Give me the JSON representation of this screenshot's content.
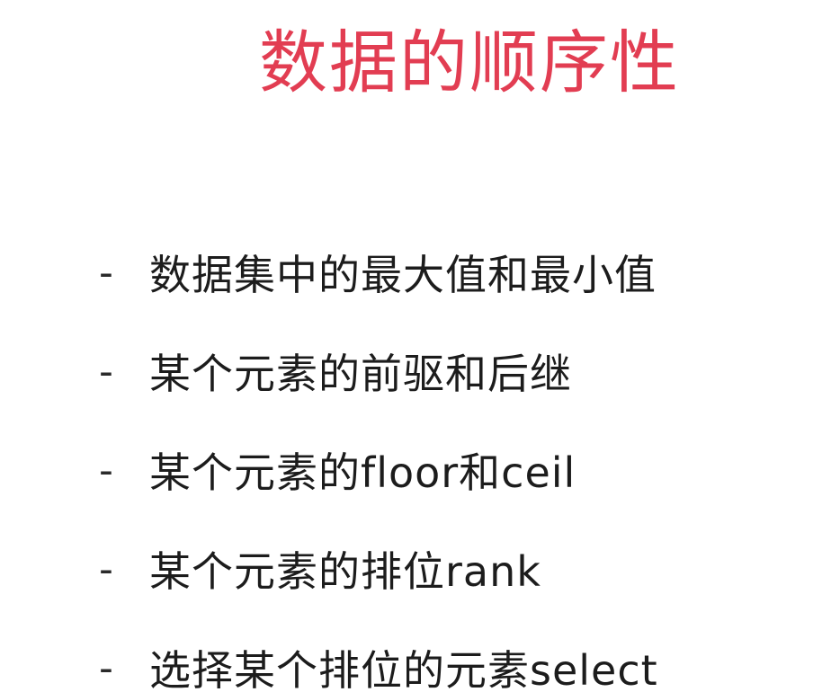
{
  "title": "数据的顺序性",
  "bullet_marker": "-",
  "bullets": [
    "数据集中的最大值和最小值",
    "某个元素的前驱和后继",
    "某个元素的floor和ceil",
    "某个元素的排位rank",
    "选择某个排位的元素select"
  ],
  "colors": {
    "title": "#e23d52",
    "text": "#1c1c1c",
    "background": "#ffffff"
  }
}
